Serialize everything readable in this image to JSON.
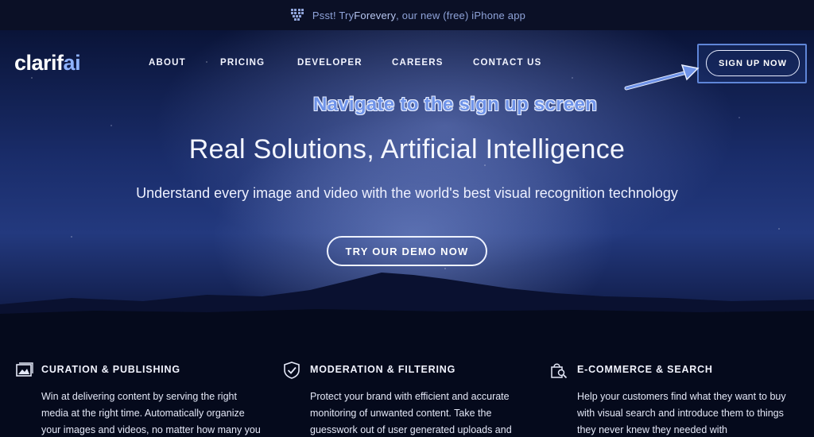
{
  "topbar": {
    "prefix": "Psst! Try ",
    "link": "Forevery",
    "suffix": ", our new (free) iPhone app",
    "icon": "heart-pixel-icon"
  },
  "logo": {
    "main": "clarif",
    "accent": "ai"
  },
  "nav": {
    "items": [
      "ABOUT",
      "PRICING",
      "DEVELOPER",
      "CAREERS",
      "CONTACT US"
    ],
    "signup_label": "SIGN UP NOW"
  },
  "annotation": {
    "text": "Navigate to the sign up screen",
    "icon": "arrow-icon"
  },
  "hero": {
    "headline": "Real Solutions, Artificial Intelligence",
    "subhead": "Understand every image and video with the world's best visual recognition technology",
    "cta_label": "TRY OUR DEMO NOW"
  },
  "features": [
    {
      "icon": "image-icon",
      "title": "CURATION & PUBLISHING",
      "lines": [
        "Win at delivering content by serving the right",
        "media at the right time. Automatically organize",
        "your images and videos, no matter how many you"
      ]
    },
    {
      "icon": "shield-check-icon",
      "title": "MODERATION & FILTERING",
      "lines": [
        "Protect your brand with efficient and accurate",
        "monitoring of unwanted content. Take the",
        "guesswork out of user generated uploads and"
      ]
    },
    {
      "icon": "shopping-bag-search-icon",
      "title": "E-COMMERCE & SEARCH",
      "lines": [
        "Help your customers find what they want to buy",
        "with visual search and introduce them to things",
        "they never knew they needed with"
      ]
    }
  ],
  "colors": {
    "accent": "#6f93e8",
    "background": "#050a1c",
    "highlight_border": "#5f86d8"
  }
}
